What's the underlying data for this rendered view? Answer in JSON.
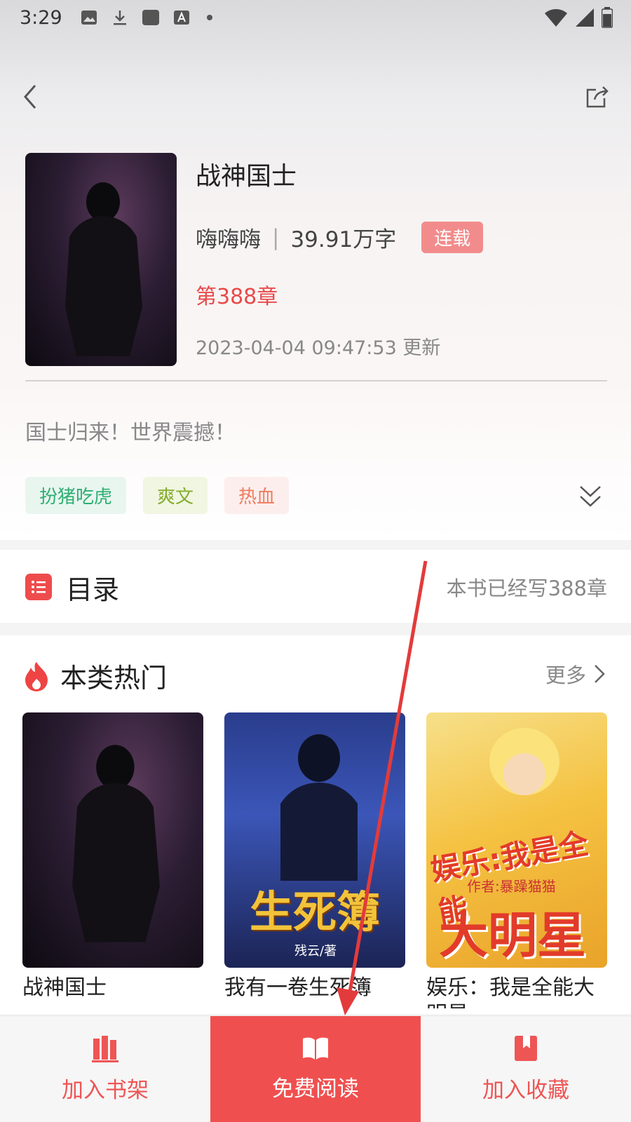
{
  "status_bar": {
    "time": "3:29"
  },
  "book": {
    "title": "战神国士",
    "author": "嗨嗨嗨",
    "separator": "|",
    "word_count": "39.91万字",
    "status_badge": "连载",
    "latest_chapter": "第388章",
    "updated": "2023-04-04 09:47:53 更新",
    "description": "国士归来！世界震撼！",
    "tags": [
      "扮猪吃虎",
      "爽文",
      "热血"
    ]
  },
  "toc": {
    "title": "目录",
    "count_text": "本书已经写388章"
  },
  "hot": {
    "title": "本类热门",
    "more_label": "更多",
    "books": [
      {
        "title": "战神国士"
      },
      {
        "title": "我有一卷生死簿",
        "cover_text": "生死簿",
        "cover_sub": "残云/著"
      },
      {
        "title": "娱乐：我是全能大明星",
        "cover_text_top": "娱乐:我是全能",
        "cover_text_main": "大明星",
        "cover_sub": "作者:暴躁猫猫"
      }
    ]
  },
  "bottom_bar": {
    "add_shelf": "加入书架",
    "free_read": "免费阅读",
    "add_favorite": "加入收藏"
  },
  "colors": {
    "accent": "#f04f4f",
    "badge": "#f28c8c",
    "chapter": "#e84a4a"
  }
}
